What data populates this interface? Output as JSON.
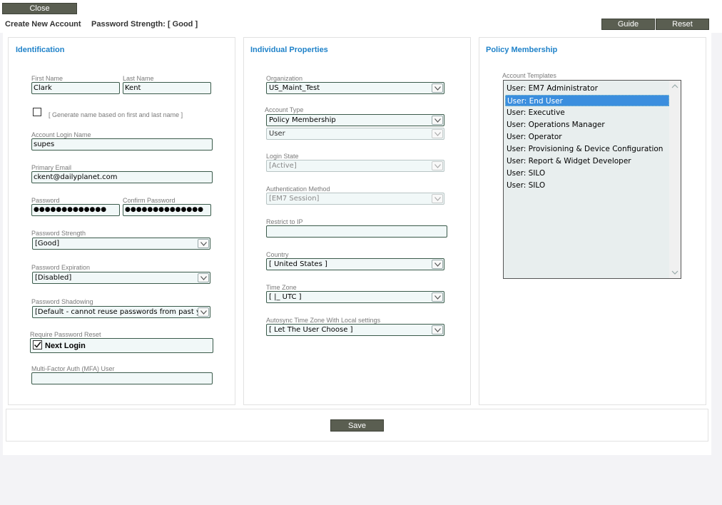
{
  "header": {
    "close_label": "Close",
    "title": "Create New Account",
    "strength_text": "Password Strength: [ Good ]",
    "guide_label": "Guide",
    "reset_label": "Reset"
  },
  "identification": {
    "title": "Identification",
    "first_name_label": "First Name",
    "first_name": "Clark",
    "last_name_label": "Last Name",
    "last_name": "Kent",
    "generate_label": "[ Generate name based on first and last name ]",
    "generate_checked": false,
    "login_label": "Account Login Name",
    "login": "supes",
    "email_label": "Primary Email",
    "email": "ckent@dailyplanet.com",
    "password_label": "Password",
    "password_mask": "●●●●●●●●●●●●●",
    "confirm_label": "Confirm Password",
    "confirm_mask": "●●●●●●●●●●●●●●",
    "strength_label": "Password Strength",
    "strength_value": "[Good]",
    "expiration_label": "Password Expiration",
    "expiration_value": "[Disabled]",
    "shadowing_label": "Password Shadowing",
    "shadowing_value": "[Default - cannot reuse passwords from past ye",
    "require_reset_label": "Require Password Reset",
    "next_login_label": "Next Login",
    "next_login_checked": true,
    "mfa_label": "Multi-Factor Auth (MFA) User",
    "mfa_value": ""
  },
  "properties": {
    "title": "Individual Properties",
    "org_label": "Organization",
    "org_value": "US_Maint_Test",
    "account_type_label": "Account Type",
    "account_type_value": "Policy Membership",
    "account_subtype_value": "User",
    "login_state_label": "Login State",
    "login_state_value": "[Active]",
    "auth_label": "Authentication Method",
    "auth_value": "[EM7 Session]",
    "restrict_label": "Restrict to IP",
    "restrict_value": "",
    "country_label": "Country",
    "country_value": "[ United States ]",
    "tz_label": "Time Zone",
    "tz_value": "[ |_ UTC ]",
    "autosync_label": "Autosync Time Zone With Local settings",
    "autosync_value": "[ Let The User Choose ]"
  },
  "policy": {
    "title": "Policy Membership",
    "templates_label": "Account Templates",
    "templates": [
      "User: EM7 Administrator",
      "User: End User",
      "User: Executive",
      "User: Operations Manager",
      "User: Operator",
      "User: Provisioning & Device Configuration",
      "User: Report & Widget Developer",
      "User: SILO",
      "User: SILO"
    ],
    "selected_index": 1
  },
  "footer": {
    "save_label": "Save"
  },
  "icons": {
    "dropdown": "chevron-down-icon",
    "check": "checkmark-icon"
  },
  "colors": {
    "button_bg": "#5a5e51",
    "section_title": "#1f82c9",
    "selection": "#3b8ede",
    "field_bg": "#f1f8f8"
  }
}
